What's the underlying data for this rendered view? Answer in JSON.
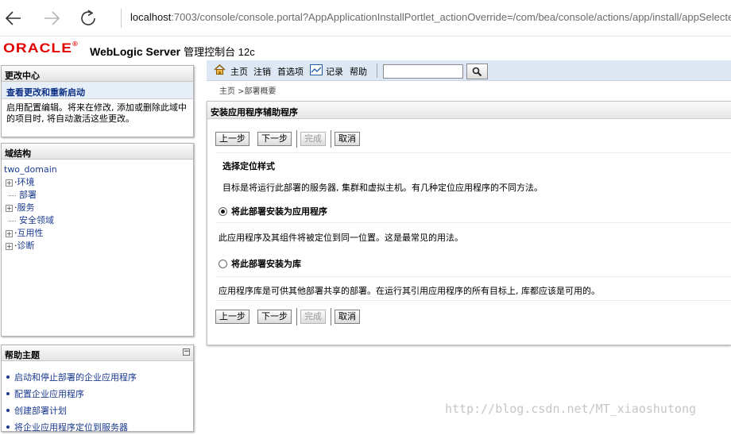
{
  "browser": {
    "url_host": "localhost",
    "url_rest": ":7003/console/console.portal?AppApplicationInstallPortlet_actionOverride=/com/bea/console/actions/app/install/appSelected"
  },
  "header": {
    "logo": "ORACLE",
    "logo_reg": "®",
    "product": "WebLogic Server",
    "product_sub": "管理控制台 12c"
  },
  "change_center": {
    "title": "更改中心",
    "link": "查看更改和重新启动",
    "text": "启用配置编辑。将来在修改, 添加或删除此域中的项目时, 将自动激活这些更改。"
  },
  "domain_structure": {
    "title": "域结构",
    "root": "two_domain",
    "items": [
      {
        "label": "环境",
        "expandable": true
      },
      {
        "label": "部署",
        "expandable": false
      },
      {
        "label": "服务",
        "expandable": true
      },
      {
        "label": "安全领域",
        "expandable": false
      },
      {
        "label": "互用性",
        "expandable": true
      },
      {
        "label": "诊断",
        "expandable": true
      }
    ]
  },
  "help": {
    "title": "帮助主题",
    "collapse": "−",
    "items": [
      "启动和停止部署的企业应用程序",
      "配置企业应用程序",
      "创建部署计划",
      "将企业应用程序定位到服务器"
    ]
  },
  "toolbar": {
    "home": "主页",
    "logout": "注销",
    "prefs": "首选项",
    "record": "记录",
    "help": "帮助"
  },
  "breadcrumb": "主页 >部署概要",
  "assistant": {
    "title": "安装应用程序辅助程序",
    "buttons": {
      "back": "上一步",
      "next": "下一步",
      "finish": "完成",
      "cancel": "取消"
    },
    "section_title": "选择定位样式",
    "section_desc": "目标是将运行此部署的服务器, 集群和虚拟主机。有几种定位应用程序的不同方法。",
    "option_app": "将此部署安装为应用程序",
    "option_app_desc": "此应用程序及其组件将被定位到同一位置。这是最常见的用法。",
    "option_app_selected": true,
    "option_lib": "将此部署安装为库",
    "option_lib_desc": "应用程序库是可供其他部署共享的部署。在运行其引用应用程序的所有目标上, 库都应该是可用的。"
  },
  "watermark": "http://blog.csdn.net/MT_xiaoshutong"
}
